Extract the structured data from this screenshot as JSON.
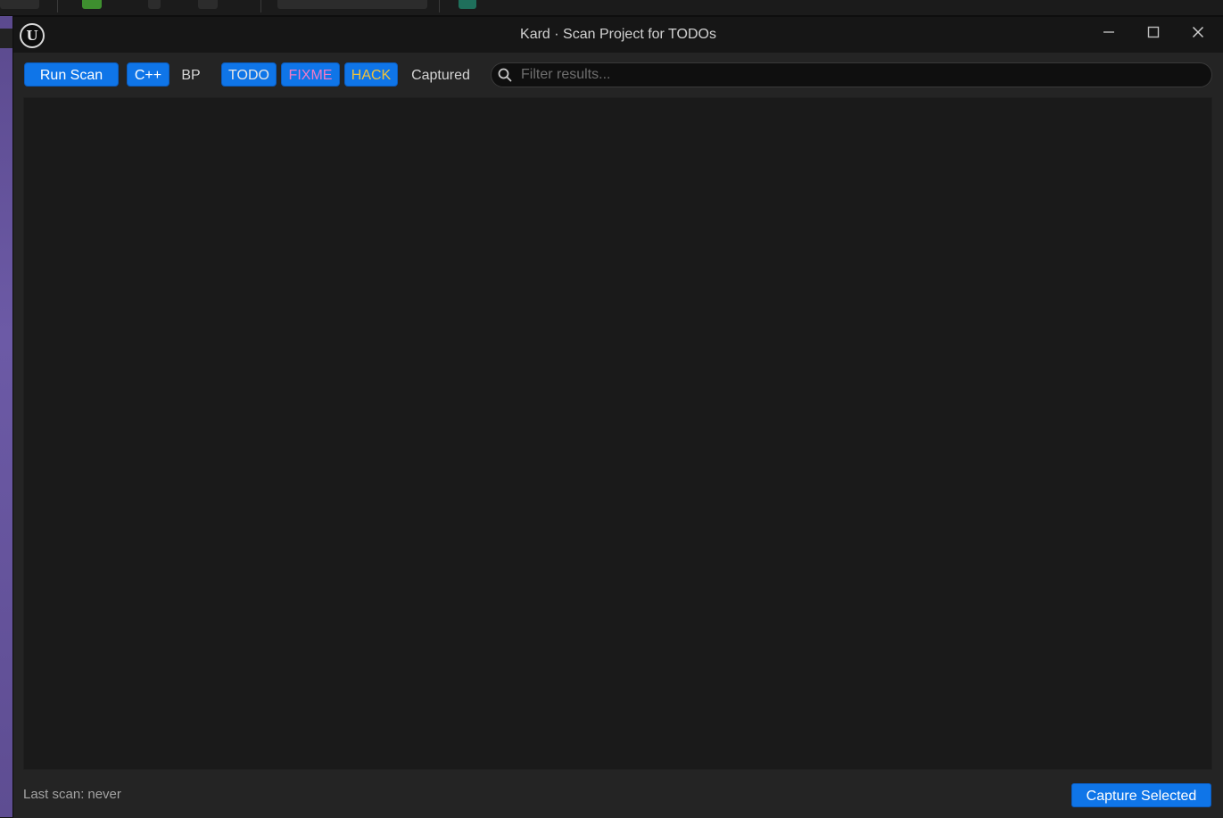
{
  "window": {
    "title": "Kard · Scan Project for TODOs",
    "logo": "unreal-logo-icon",
    "controls": [
      "minimize-icon",
      "maximize-icon",
      "close-icon"
    ]
  },
  "toolbar": {
    "run_scan_label": "Run Scan",
    "source_filters": [
      {
        "label": "C++",
        "active": true
      },
      {
        "label": "BP",
        "active": false
      }
    ],
    "tag_filters": [
      {
        "label": "TODO",
        "active": true,
        "color": "#e7e7e7"
      },
      {
        "label": "FIXME",
        "active": true,
        "color": "#f27ac6"
      },
      {
        "label": "HACK",
        "active": true,
        "color": "#f0c23a"
      }
    ],
    "captured_label": "Captured",
    "captured_active": false
  },
  "search": {
    "placeholder": "Filter results...",
    "value": "",
    "icon": "search-icon"
  },
  "results": {
    "items": []
  },
  "status": {
    "last_scan_label": "Last scan:",
    "last_scan_value": "never"
  },
  "footer": {
    "capture_label": "Capture Selected"
  },
  "colors": {
    "accent": "#0f75e8",
    "window_bg": "#242424",
    "titlebar_bg": "#161616",
    "results_bg": "#1a1a1a"
  }
}
